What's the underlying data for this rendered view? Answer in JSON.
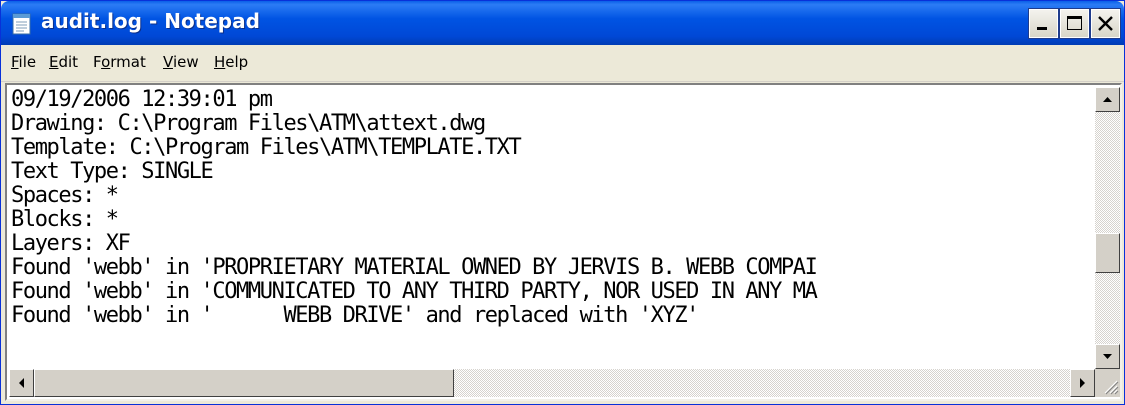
{
  "window": {
    "title": "audit.log - Notepad",
    "app_icon": "notepad-icon"
  },
  "title_buttons": {
    "minimize_icon": "minimize-icon",
    "maximize_icon": "maximize-icon",
    "close_icon": "close-icon"
  },
  "menu": {
    "items": [
      {
        "label": "File",
        "mnemonic": "F",
        "rest": "ile"
      },
      {
        "label": "Edit",
        "mnemonic": "E",
        "rest": "dit"
      },
      {
        "label": "Format",
        "pre": "F",
        "mnemonic": "o",
        "rest": "rmat"
      },
      {
        "label": "View",
        "mnemonic": "V",
        "rest": "iew"
      },
      {
        "label": "Help",
        "mnemonic": "H",
        "rest": "elp"
      }
    ]
  },
  "document": {
    "lines": [
      "09/19/2006 12:39:01 pm",
      "Drawing: C:\\Program Files\\ATM\\attext.dwg",
      "Template: C:\\Program Files\\ATM\\TEMPLATE.TXT",
      "Text Type: SINGLE",
      "Spaces: *",
      "Blocks: *",
      "Layers: XF",
      "Found 'webb' in 'PROPRIETARY MATERIAL OWNED BY JERVIS B. WEBB COMPAI",
      "Found 'webb' in 'COMMUNICATED TO ANY THIRD PARTY, NOR USED IN ANY MA",
      "Found 'webb' in '      WEBB DRIVE' and replaced with 'XYZ'"
    ]
  },
  "scrollbars": {
    "vertical_position": 0.45,
    "horizontal_position": 0.0,
    "icons": [
      "scroll-up-icon",
      "scroll-down-icon",
      "scroll-left-icon",
      "scroll-right-icon"
    ]
  },
  "colors": {
    "titlebar": "#0054e3",
    "title_text": "#ffffff",
    "menu_bg": "#ece9d8",
    "edit_bg": "#ffffff"
  }
}
